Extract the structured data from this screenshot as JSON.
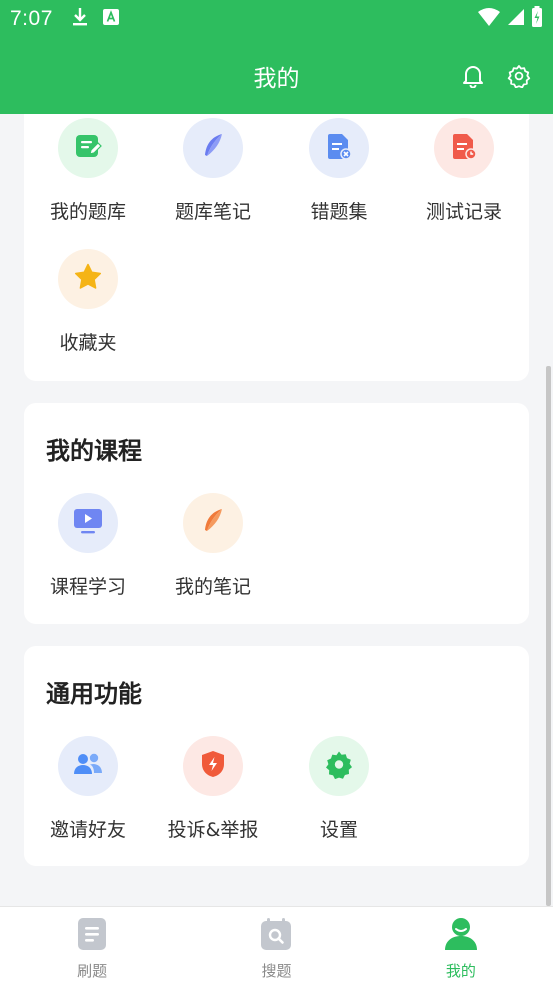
{
  "status_bar": {
    "time": "7:07"
  },
  "header": {
    "title": "我的"
  },
  "sections": [
    {
      "title": "",
      "items": [
        {
          "label": "我的题库",
          "icon": "question-bank-icon"
        },
        {
          "label": "题库笔记",
          "icon": "feather-icon"
        },
        {
          "label": "错题集",
          "icon": "wrong-questions-icon"
        },
        {
          "label": "测试记录",
          "icon": "test-record-icon"
        },
        {
          "label": "收藏夹",
          "icon": "star-icon"
        }
      ]
    },
    {
      "title": "我的课程",
      "items": [
        {
          "label": "课程学习",
          "icon": "video-icon"
        },
        {
          "label": "我的笔记",
          "icon": "feather-icon"
        }
      ]
    },
    {
      "title": "通用功能",
      "items": [
        {
          "label": "邀请好友",
          "icon": "users-icon"
        },
        {
          "label": "投诉&举报",
          "icon": "shield-icon"
        },
        {
          "label": "设置",
          "icon": "gear-icon"
        }
      ]
    }
  ],
  "tabs": [
    {
      "label": "刷题",
      "icon": "document-icon"
    },
    {
      "label": "搜题",
      "icon": "search-icon"
    },
    {
      "label": "我的",
      "icon": "user-icon"
    }
  ],
  "colors": {
    "brand": "#2dbd5e",
    "text": "#333333",
    "tab_inactive": "#8a8a8a"
  }
}
